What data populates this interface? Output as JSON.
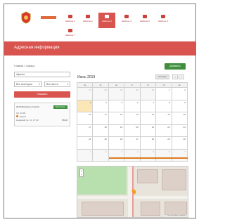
{
  "header": {
    "nav": [
      {
        "label": "Шаблон 1",
        "active": false
      },
      {
        "label": "Шаблон 2",
        "active": false
      },
      {
        "label": "Шаблон 3",
        "active": true
      },
      {
        "label": "Шаблон 4",
        "active": false
      },
      {
        "label": "Шаблон 5",
        "active": false
      },
      {
        "label": "Шаблон 6",
        "active": false
      },
      {
        "label": "Шаблон 7",
        "active": false
      }
    ],
    "brand_color": "#d9534f"
  },
  "page": {
    "title": "Адресная информация",
    "breadcrumb": "Главная » Афиша",
    "add_label": "Добавить"
  },
  "filters": {
    "search_value": "Афиша",
    "select_category": "Все категории",
    "select_place": "Все места",
    "apply_label": "Показать"
  },
  "event": {
    "title": "2019 Blackberry Festival",
    "badge": "Бесплатно",
    "line2": "Сб, 10:00",
    "place": "Музей",
    "meta": "Нарвский пр. 10, 17:30",
    "price": "$5.00"
  },
  "calendar": {
    "month": "Июнь 2019",
    "today_label": "Сегодня",
    "prev": "‹",
    "next": "›",
    "weekdays": [
      "пн",
      "вт",
      "ср",
      "чт",
      "пт",
      "сб",
      "вс"
    ],
    "weeks": [
      [
        "27",
        "28",
        "29",
        "30",
        "31",
        "1",
        "2"
      ],
      [
        "3",
        "4",
        "5",
        "6",
        "7",
        "8",
        "9"
      ],
      [
        "10",
        "11",
        "12",
        "13",
        "14",
        "15",
        "16"
      ],
      [
        "17",
        "18",
        "19",
        "20",
        "21",
        "22",
        "23"
      ],
      [
        "24",
        "25",
        "26",
        "27",
        "28",
        "29",
        "30"
      ],
      [
        "1",
        "2",
        "3",
        "4",
        "5",
        "6",
        "7"
      ]
    ],
    "event_color": "#e07a1f"
  },
  "map": {
    "zoom": "+\n−",
    "attribution": "© OpenStreetMap contributors"
  }
}
